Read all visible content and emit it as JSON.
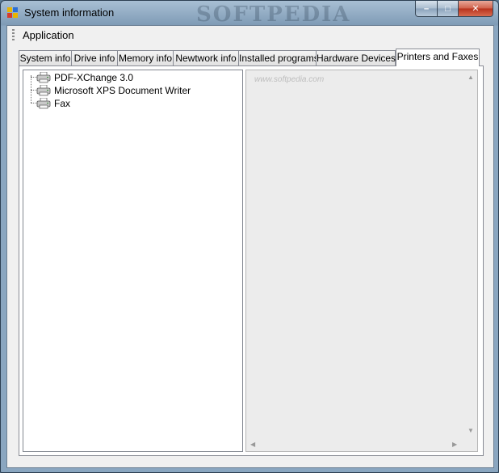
{
  "window": {
    "title": "System information",
    "watermark": "SOFTPEDIA",
    "caption": {
      "minimize": "–",
      "maximize": "□",
      "close": "✕"
    }
  },
  "menu": {
    "application_label": "Application"
  },
  "tabs": [
    {
      "label": "System info"
    },
    {
      "label": "Drive info"
    },
    {
      "label": "Memory info"
    },
    {
      "label": "Newtwork info"
    },
    {
      "label": "Installed programs"
    },
    {
      "label": "Hardware Devices"
    },
    {
      "label": "Printers and Faxes"
    }
  ],
  "active_tab": "Printers and Faxes",
  "printers": [
    {
      "label": "PDF-XChange 3.0"
    },
    {
      "label": "Microsoft XPS Document Writer"
    },
    {
      "label": "Fax"
    }
  ],
  "detail": {
    "watermark": "www.softpedia.com"
  },
  "icons": {
    "app": "app-window-icon",
    "printer": "printer-icon",
    "scroll_up": "scroll-up-icon",
    "scroll_down": "scroll-down-icon",
    "scroll_left": "scroll-left-icon",
    "scroll_right": "scroll-right-icon"
  },
  "colors": {
    "accent": "#7f9bb6",
    "close": "#c0392b"
  }
}
